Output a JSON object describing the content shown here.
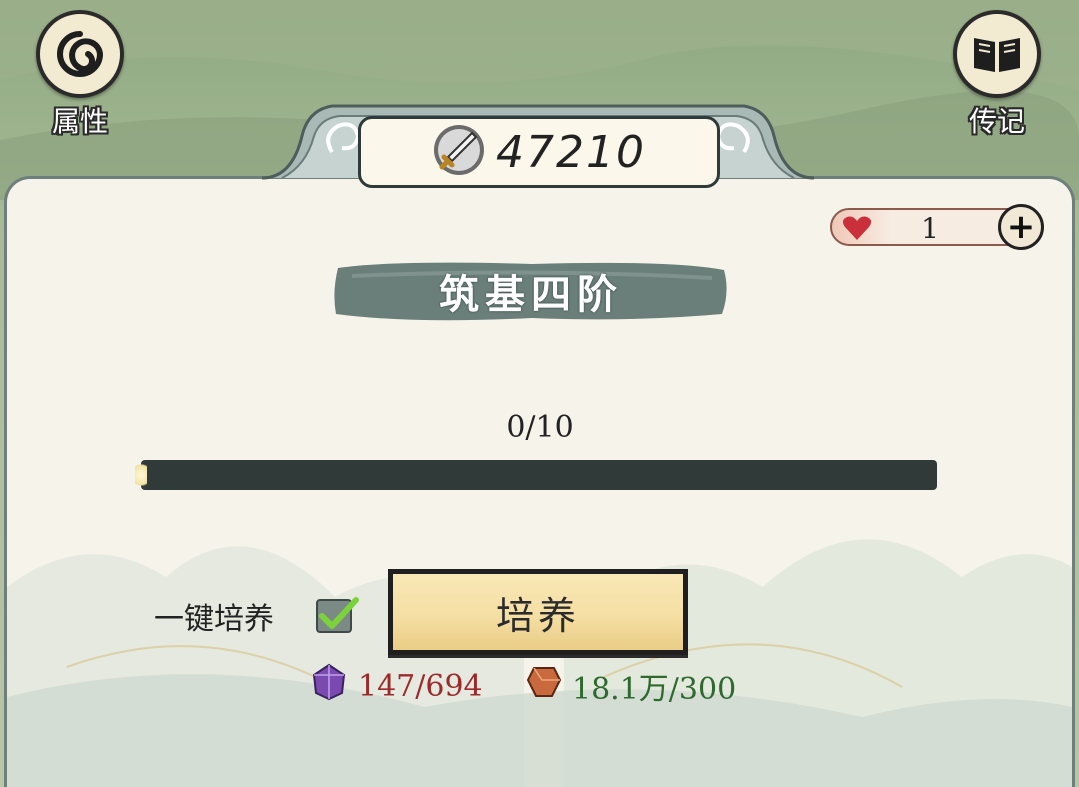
{
  "top_left_button": {
    "label": "属性",
    "icon": "swirl-icon"
  },
  "top_right_button": {
    "label": "传记",
    "icon": "book-icon"
  },
  "combat_power": {
    "value": "47210",
    "icon": "sword-icon"
  },
  "lives": {
    "count": "1",
    "icon": "heart-icon",
    "add_icon": "plus-icon"
  },
  "rank": {
    "title": "筑基四阶"
  },
  "progress": {
    "label": "0/10",
    "current": 0,
    "max": 10
  },
  "auto_cultivate": {
    "label": "一键培养",
    "checked": true
  },
  "cultivate_button": {
    "label": "培养"
  },
  "costs": [
    {
      "icon": "purple-crystal-icon",
      "value": "147/694",
      "color": "#9b2b2b"
    },
    {
      "icon": "copper-ore-icon",
      "value": "18.1万/300",
      "color": "#2e6a2e"
    }
  ],
  "colors": {
    "panel": "#f5f3ea",
    "dark_teal": "#303b39",
    "button_gold": "#f5dfa3"
  }
}
